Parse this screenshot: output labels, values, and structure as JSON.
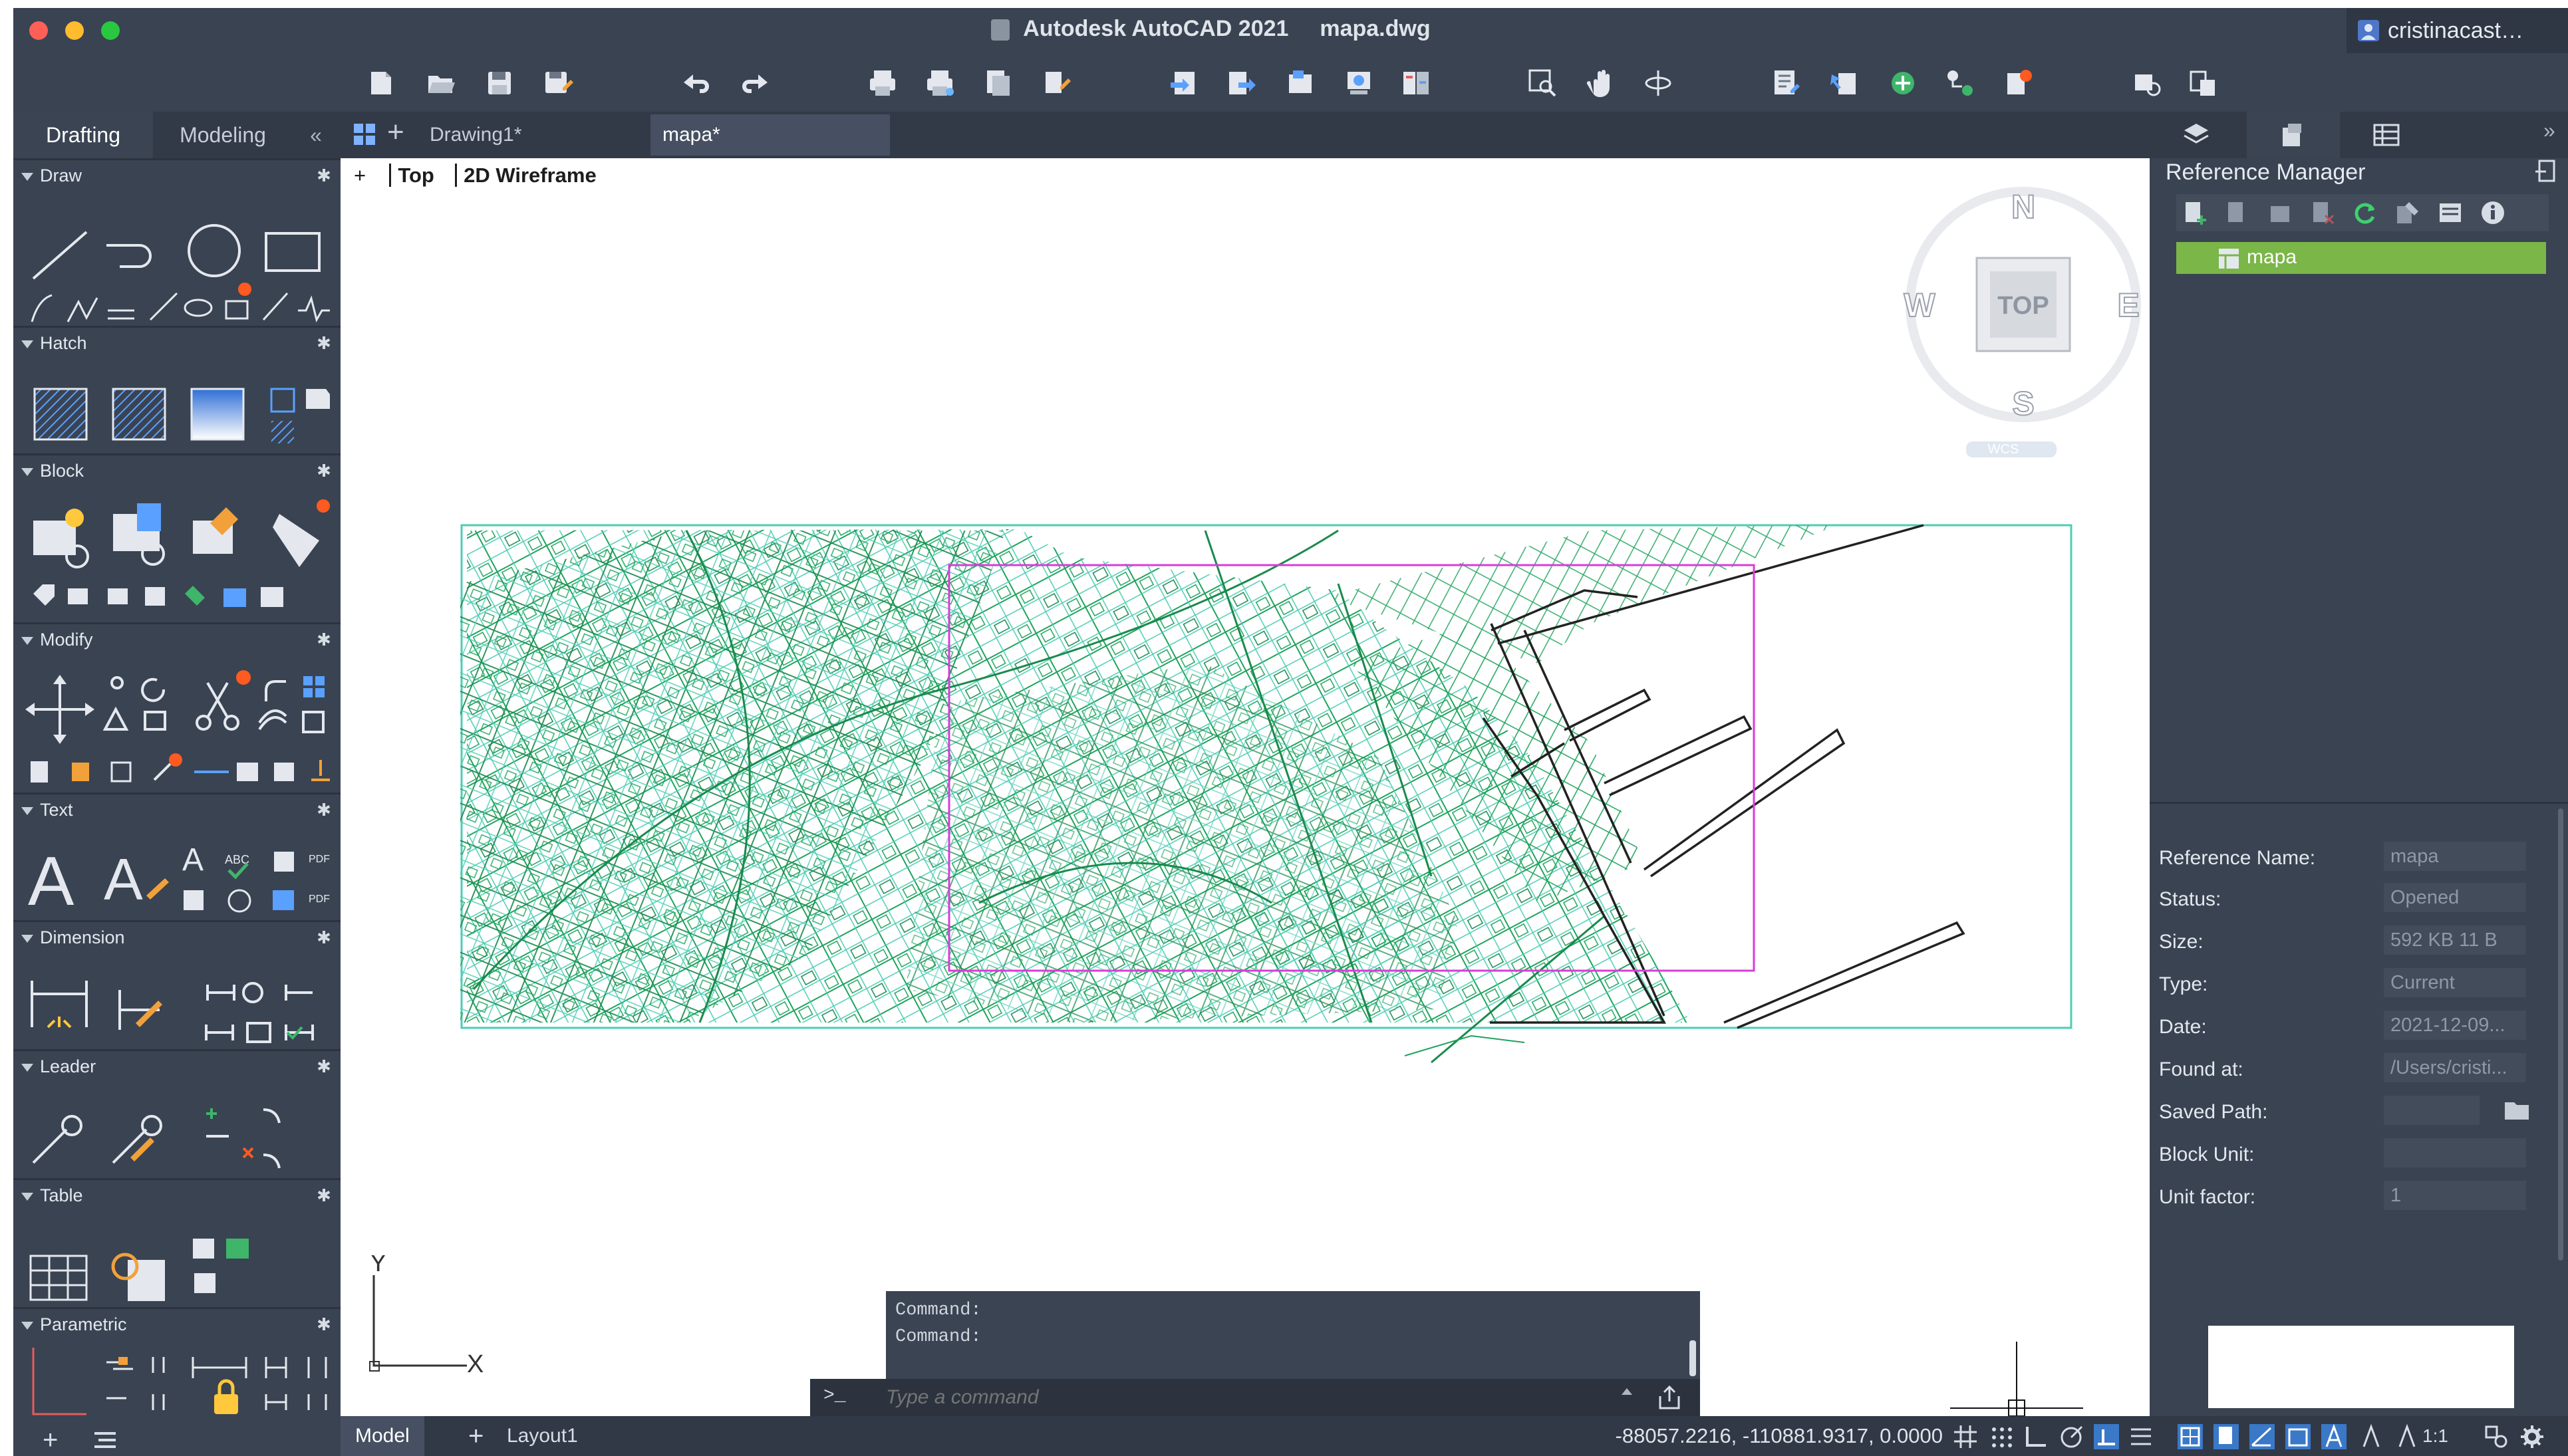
{
  "window": {
    "title": "Autodesk AutoCAD 2021",
    "document": "mapa.dwg",
    "user": "cristinacast…",
    "colors": {
      "close": "#fe5f57",
      "minimize": "#febc2e",
      "maximize": "#28c840",
      "accent_green": "#7ab648",
      "drawing_green": "#1fa35e",
      "drawing_teal": "#4ecdb3",
      "magenta_frame": "#d83cd8"
    }
  },
  "toolbar": {
    "icons": [
      "new-icon",
      "open-icon",
      "save-icon",
      "save-as-icon",
      "undo-icon",
      "redo-icon",
      "plot-icon",
      "batch-plot-icon",
      "plot-preview-icon",
      "publish-icon",
      "import-icon",
      "export-icon",
      "attach-icon",
      "share-icon",
      "layers-icon",
      "zoom-window-icon",
      "pan-icon",
      "orbit-icon",
      "properties-icon",
      "match-properties-icon",
      "xref-icon",
      "layer-states-icon",
      "markup-icon",
      "quick-view-icon",
      "sheet-set-icon"
    ]
  },
  "left_panel": {
    "tabs": [
      "Drafting",
      "Modeling"
    ],
    "collapse": "«",
    "sections": [
      {
        "title": "Draw"
      },
      {
        "title": "Hatch"
      },
      {
        "title": "Block"
      },
      {
        "title": "Modify"
      },
      {
        "title": "Text"
      },
      {
        "title": "Dimension"
      },
      {
        "title": "Leader"
      },
      {
        "title": "Table"
      },
      {
        "title": "Parametric"
      }
    ]
  },
  "file_tabs": [
    {
      "label": "Drawing1*",
      "active": false
    },
    {
      "label": "mapa*",
      "active": true
    }
  ],
  "viewport": {
    "plus": "+",
    "view": "Top",
    "visual_style": "2D Wireframe"
  },
  "viewcube": {
    "north": "N",
    "south": "S",
    "east": "E",
    "west": "W",
    "face": "TOP",
    "wcs": "WCS"
  },
  "ucs": {
    "x": "X",
    "y": "Y"
  },
  "command": {
    "history": [
      "Command:",
      "Command:"
    ],
    "prompt_glyph": ">_",
    "placeholder": "Type a command"
  },
  "right_panel": {
    "title": "Reference Manager",
    "tree_item": "mapa",
    "properties": [
      {
        "label": "Reference Name:",
        "value": "mapa"
      },
      {
        "label": "Status:",
        "value": "Opened"
      },
      {
        "label": "Size:",
        "value": "592 KB 11 B"
      },
      {
        "label": "Type:",
        "value": "Current"
      },
      {
        "label": "Date:",
        "value": "2021-12-09..."
      },
      {
        "label": "Found at:",
        "value": "/Users/cristi..."
      },
      {
        "label": "Saved Path:",
        "value": ""
      },
      {
        "label": "Block Unit:",
        "value": ""
      },
      {
        "label": "Unit factor:",
        "value": "1"
      }
    ]
  },
  "status_bar": {
    "tabs": [
      "Model",
      "Layout1"
    ],
    "add": "+",
    "coordinates": "-88057.2216, -110881.9317, 0.0000",
    "annotation_scale": "1:1"
  }
}
